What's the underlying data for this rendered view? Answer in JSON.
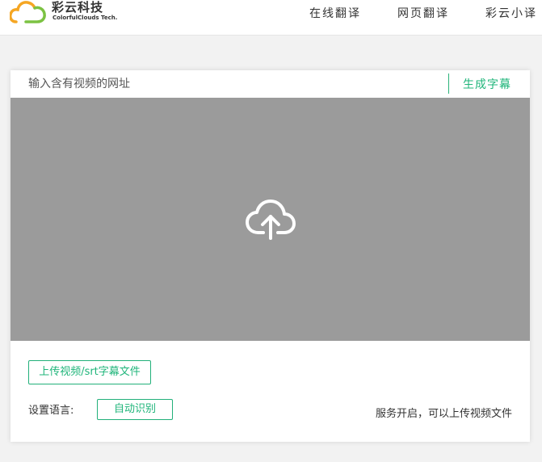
{
  "header": {
    "logo": {
      "name_cn": "彩云科技",
      "name_en": "ColorfulClouds Tech."
    },
    "nav": [
      {
        "label": "在线翻译"
      },
      {
        "label": "网页翻译"
      },
      {
        "label": "彩云小译"
      }
    ]
  },
  "main": {
    "url_input": {
      "placeholder": "输入含有视频的网址",
      "value": ""
    },
    "generate_label": "生成字幕",
    "upload_area": {
      "icon": "cloud-upload-icon"
    },
    "upload_button_label": "上传视频/srt字幕文件",
    "language": {
      "label": "设置语言:",
      "selected": "自动识别"
    },
    "status_text": "服务开启，可以上传视频文件"
  },
  "colors": {
    "accent": "#1fb57a",
    "upload_bg": "#9b9b9b",
    "page_bg": "#f2f2f2",
    "logo_orange": "#f5a623",
    "logo_green": "#7cc242"
  }
}
